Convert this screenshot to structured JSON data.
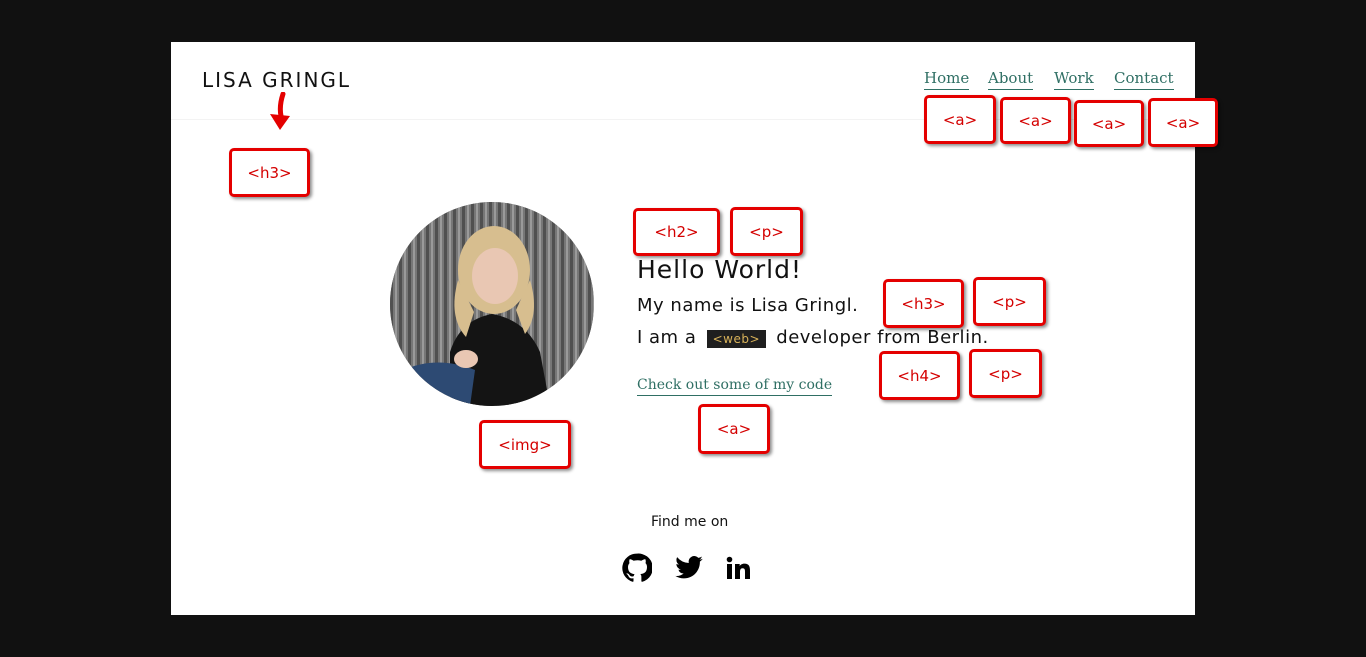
{
  "site": {
    "logo": "LISA GRINGL",
    "nav": [
      "Home",
      "About",
      "Work",
      "Contact"
    ]
  },
  "hero": {
    "title": "Hello World!",
    "intro": "My name is Lisa Gringl.",
    "line_before": "I am a",
    "code_word": "<web>",
    "line_after": "developer from Berlin.",
    "link": "Check out some of my code"
  },
  "footer": {
    "find_me": "Find me on",
    "social_icons": [
      "github-icon",
      "twitter-icon",
      "linkedin-icon"
    ]
  },
  "annotations": {
    "nav_tags": [
      "<a>",
      "<a>",
      "<a>",
      "<a>"
    ],
    "h3_logo": "<h3>",
    "h2": "<h2>",
    "p1": "<p>",
    "h3_intro": "<h3>",
    "p2": "<p>",
    "h4": "<h4>",
    "p3": "<p>",
    "img": "<img>",
    "link": "<a>"
  },
  "colors": {
    "background": "#111111",
    "card": "#ffffff",
    "accent": "#2f6f64",
    "annotation": "#e40000",
    "code_bg": "#1f1f1f",
    "code_text": "#d8b25a"
  }
}
